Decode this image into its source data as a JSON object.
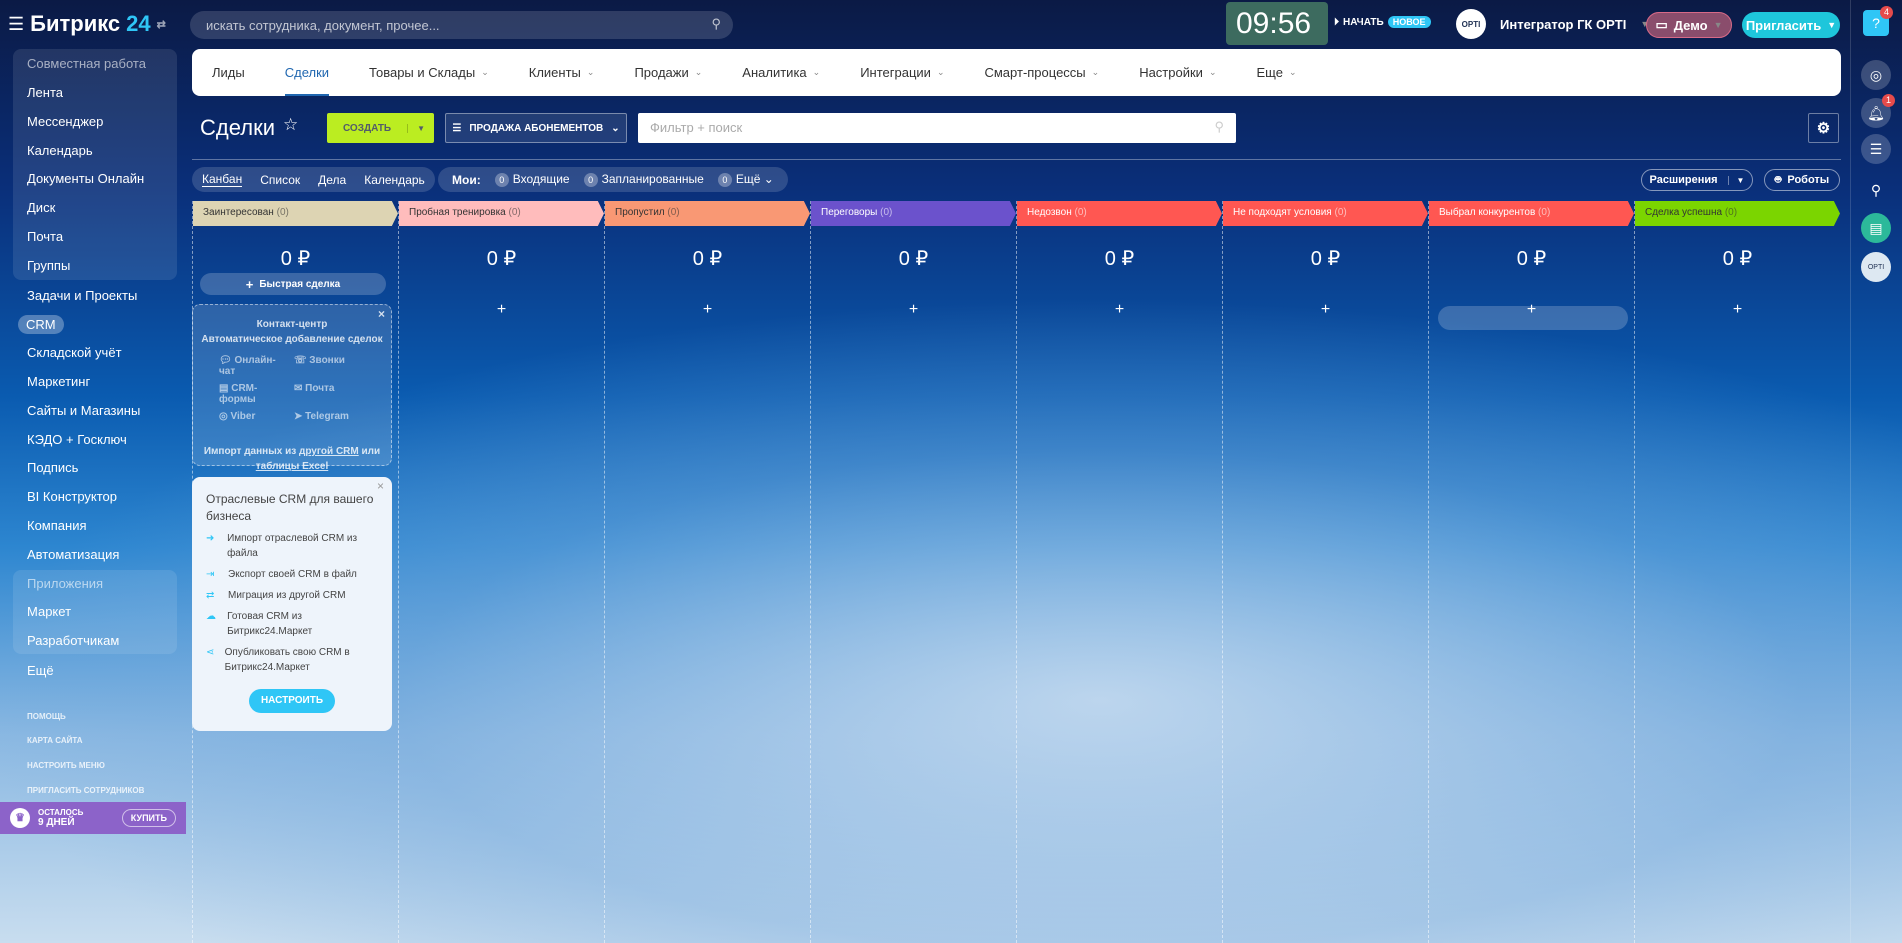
{
  "topbar": {
    "logo": "Битрикс",
    "logo_num": "24",
    "search_placeholder": "искать сотрудника, документ, прочее...",
    "clock": "09:56",
    "start": "НАЧАТЬ",
    "new_badge": "НОВОЕ",
    "user": "Интегратор ГК OPTI",
    "avatar_text": "OPTI",
    "demo": "Демо",
    "invite": "Пригласить"
  },
  "nav": {
    "items": [
      "Лиды",
      "Сделки",
      "Товары и Склады",
      "Клиенты",
      "Продажи",
      "Аналитика",
      "Интеграции",
      "Смарт-процессы",
      "Настройки",
      "Еще"
    ]
  },
  "sidebar": {
    "items": [
      "Совместная работа",
      "Лента",
      "Мессенджер",
      "Календарь",
      "Документы Онлайн",
      "Диск",
      "Почта",
      "Группы",
      "Задачи и Проекты",
      "CRM",
      "Складской учёт",
      "Маркетинг",
      "Сайты и Магазины",
      "КЭДО + Госключ",
      "Подпись",
      "BI Конструктор",
      "Компания",
      "Автоматизация",
      "Приложения",
      "Маркет",
      "Разработчикам",
      "Ещё"
    ],
    "footer": [
      "ПОМОЩЬ",
      "КАРТА САЙТА",
      "НАСТРОИТЬ МЕНЮ",
      "ПРИГЛАСИТЬ СОТРУДНИКОВ"
    ],
    "trial": {
      "left": "ОСТАЛОСЬ",
      "days": "9 ДНЕЙ",
      "buy": "КУПИТЬ"
    }
  },
  "toolbar": {
    "title": "Сделки",
    "create": "СОЗДАТЬ",
    "pipeline": "ПРОДАЖА АБОНЕМЕНТОВ",
    "filter_placeholder": "Фильтр + поиск",
    "extensions": "Расширения",
    "robots": "Роботы"
  },
  "views": {
    "tabs": [
      "Канбан",
      "Список",
      "Дела",
      "Календарь"
    ],
    "mine": "Мои:",
    "counters": [
      {
        "n": "0",
        "label": "Входящие"
      },
      {
        "n": "0",
        "label": "Запланированные"
      },
      {
        "n": "0",
        "label": "Ещё"
      }
    ]
  },
  "columns": [
    {
      "name": "Заинтересован",
      "count": "(0)",
      "sum": "0 ₽",
      "color": "#ddd4b3",
      "text": "#333"
    },
    {
      "name": "Пробная тренировка",
      "count": "(0)",
      "sum": "0 ₽",
      "color": "#ffbcbc",
      "text": "#333"
    },
    {
      "name": "Пропустил",
      "count": "(0)",
      "sum": "0 ₽",
      "color": "#f99874",
      "text": "#333"
    },
    {
      "name": "Переговоры",
      "count": "(0)",
      "sum": "0 ₽",
      "color": "#6b52cc",
      "text": "#fff"
    },
    {
      "name": "Недозвон",
      "count": "(0)",
      "sum": "0 ₽",
      "color": "#ff5752",
      "text": "#fff"
    },
    {
      "name": "Не подходят условия",
      "count": "(0)",
      "sum": "0 ₽",
      "color": "#ff5752",
      "text": "#fff"
    },
    {
      "name": "Выбрал конкурентов",
      "count": "(0)",
      "sum": "0 ₽",
      "color": "#ff5752",
      "text": "#fff"
    },
    {
      "name": "Сделка успешна",
      "count": "(0)",
      "sum": "0 ₽",
      "color": "#7bd500",
      "text": "#333"
    }
  ],
  "quick_deal": "Быстрая сделка",
  "contact_center": {
    "title": "Контакт-центр",
    "subtitle": "Автоматическое добавление сделок",
    "channels": [
      "Онлайн-чат",
      "Звонки",
      "CRM-формы",
      "Почта",
      "Viber",
      "Telegram"
    ],
    "import_pre": "Импорт данных из ",
    "import_link1": "другой CRM",
    "import_mid": " или ",
    "import_link2": "таблицы Excel"
  },
  "industry": {
    "title": "Отраслевые CRM для вашего бизнеса",
    "items": [
      "Импорт отраслевой CRM из файла",
      "Экспорт своей CRM в файл",
      "Миграция из другой CRM",
      "Готовая CRM из Битрикс24.Маркет",
      "Опубликовать свою CRM в Битрикс24.Маркет"
    ],
    "button": "НАСТРОИТЬ"
  },
  "right_panel": {
    "help_badge": "4",
    "notif_badge": "1"
  }
}
